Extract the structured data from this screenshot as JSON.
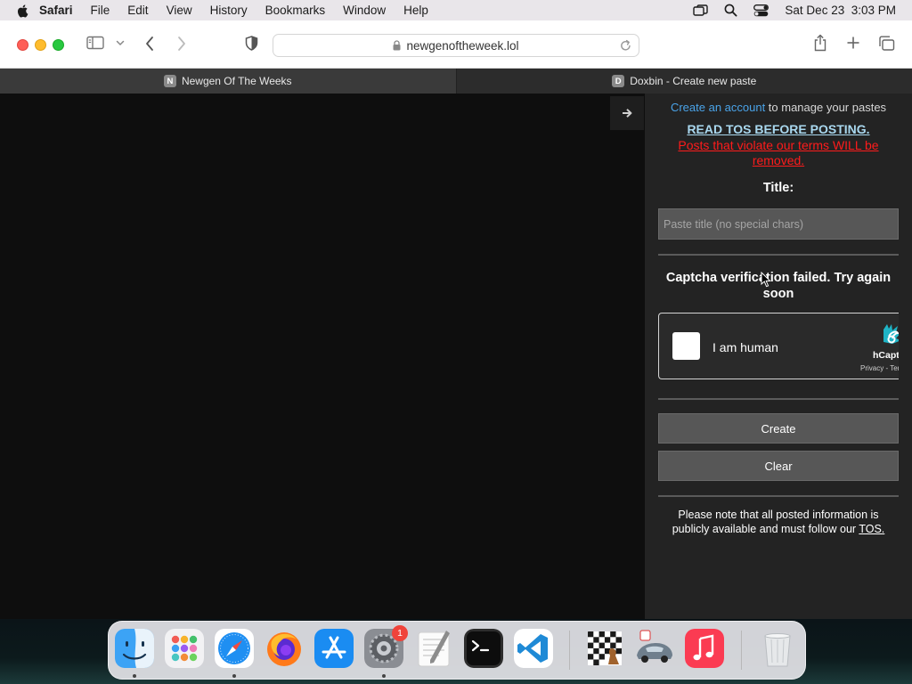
{
  "menubar": {
    "app_name": "Safari",
    "items": [
      "File",
      "Edit",
      "View",
      "History",
      "Bookmarks",
      "Window",
      "Help"
    ],
    "clock": "Sat Dec 23  3:03 PM"
  },
  "toolbar": {
    "url": "newgenoftheweek.lol"
  },
  "tabs": [
    {
      "favicon_letter": "N",
      "title": "Newgen Of The Weeks"
    },
    {
      "favicon_letter": "D",
      "title": "Doxbin - Create new paste"
    }
  ],
  "sidebar": {
    "account_link": "Create an account",
    "account_suffix": " to manage your pastes",
    "tos_heading": "READ TOS BEFORE POSTING.",
    "tos_warning": "Posts that violate our terms WILL be removed.",
    "title_label": "Title:",
    "title_placeholder": "Paste title (no special chars)",
    "captcha_message": "Captcha verification failed. Try again soon",
    "captcha": {
      "checkbox_label": "I am human",
      "brand": "hCaptcha",
      "privacy": "Privacy - Terms"
    },
    "create_label": "Create",
    "clear_label": "Clear",
    "note_prefix": "Please note that all posted information is publicly available and must follow our ",
    "note_link": "TOS."
  },
  "dock": {
    "apps": [
      "Finder",
      "Launchpad",
      "Safari",
      "Firefox",
      "App Store",
      "System Preferences",
      "TextEdit",
      "Terminal",
      "Visual Studio Code",
      "Chess",
      "Race Game",
      "Music",
      "Trash"
    ],
    "notification_badge": "1"
  },
  "colors": {
    "link_blue": "#4aa3e8",
    "tos_heading": "#a9d8ef",
    "warning_red": "#ff1b1b",
    "sidebar_bg": "#232323",
    "button_bg": "#575757"
  }
}
